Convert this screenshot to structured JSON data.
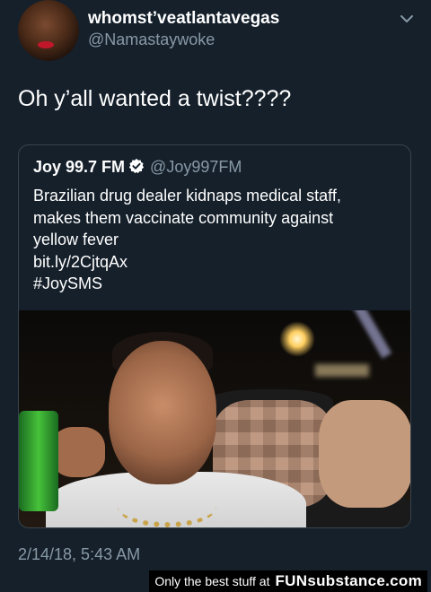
{
  "tweet": {
    "display_name": "whomst’veatlantavegas",
    "handle": "@Namastaywoke",
    "text": "Oh y’all wanted a twist????",
    "timestamp": "2/14/18, 5:43 AM",
    "menu_icon": "chevron-down-icon"
  },
  "quoted_tweet": {
    "display_name": "Joy 99.7 FM",
    "verified_icon": "verified-badge-icon",
    "handle": "@Joy997FM",
    "lines": [
      "Brazilian drug dealer kidnaps medical staff,",
      "makes them vaccinate community against",
      "yellow fever",
      "bit.ly/2CjtqAx",
      "#JoySMS"
    ]
  },
  "watermark": {
    "text": "Only the best stuff at",
    "brand": "FUNsubstance.com"
  },
  "colors": {
    "background": "#15202b",
    "secondary_text": "#8899a6",
    "border": "#38444d",
    "verified": "#ffffff"
  }
}
